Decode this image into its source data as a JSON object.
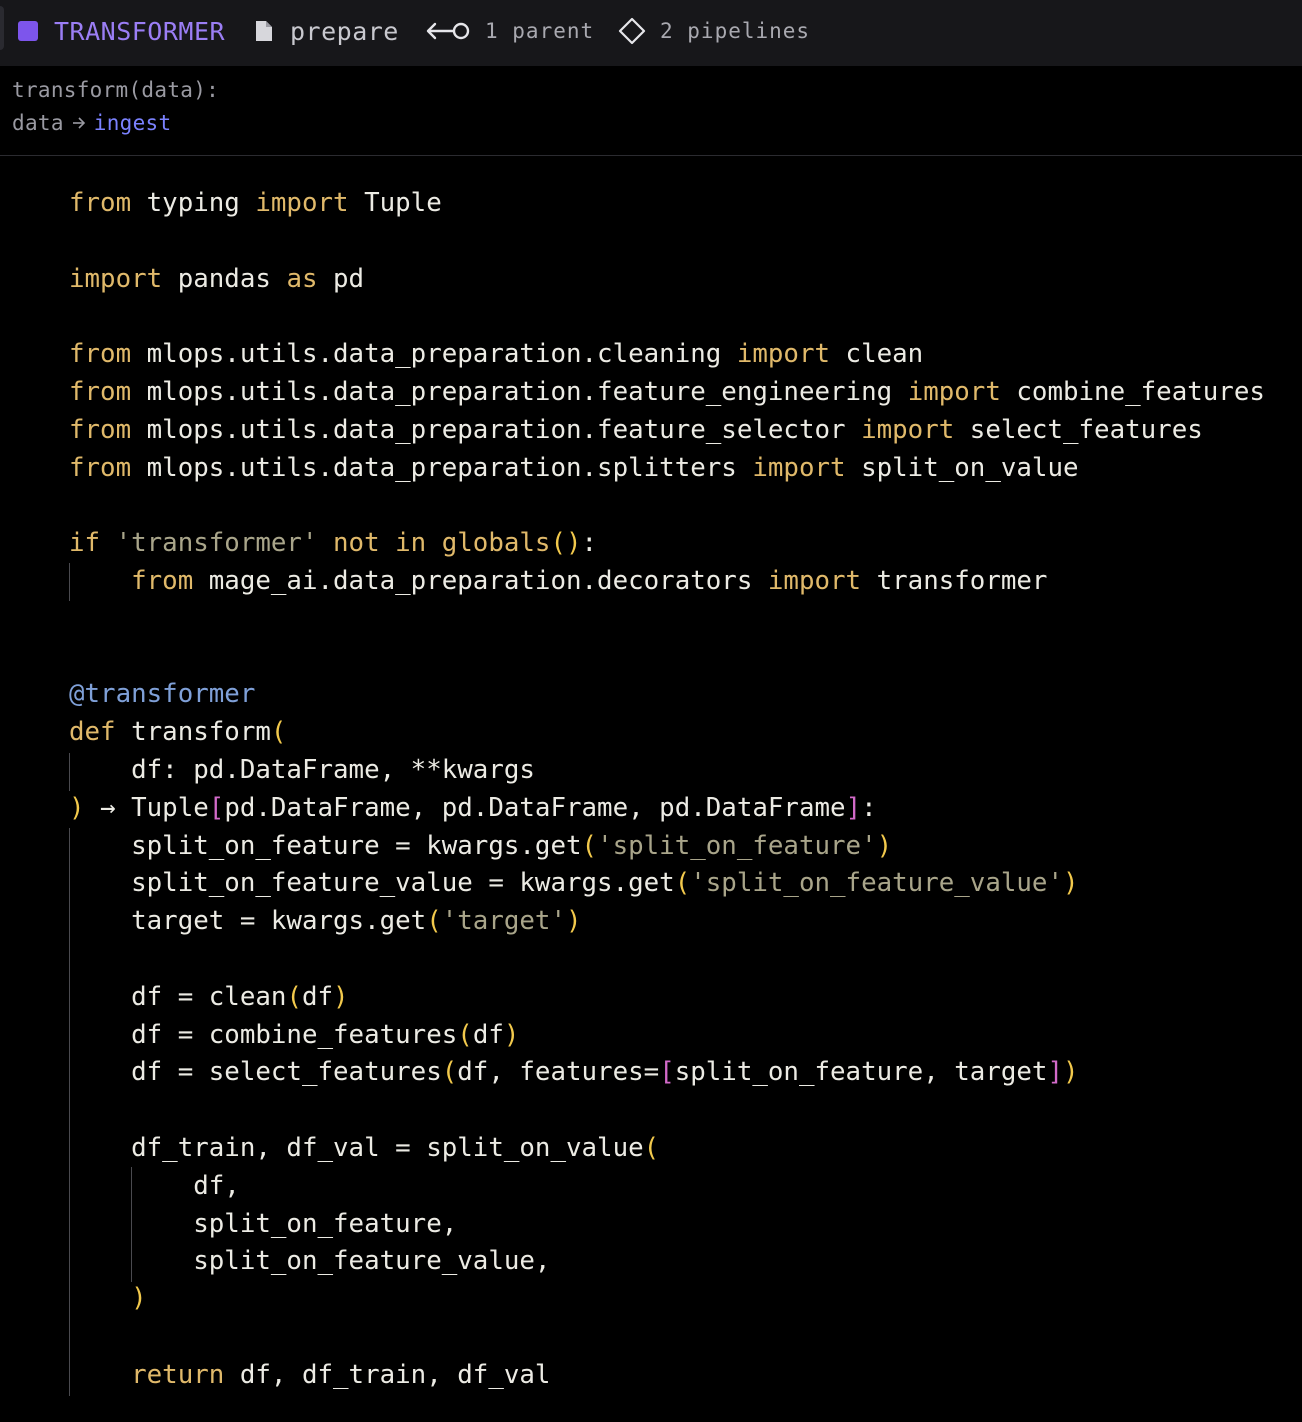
{
  "header": {
    "block_type": "TRANSFORMER",
    "block_type_color": "#7d55ec",
    "file_icon": "file-icon",
    "block_name": "prepare",
    "parents_icon": "parent-link-icon",
    "parents_text": "1 parent",
    "pipelines_icon": "diamond-icon",
    "pipelines_text": "2 pipelines"
  },
  "signature": {
    "function": "transform(data):",
    "flow_from": "data",
    "flow_arrow_icon": "arrow-right-icon",
    "flow_to": "ingest"
  },
  "code": {
    "l1": [
      {
        "t": "from",
        "c": "kw"
      },
      {
        "t": " typing ",
        "c": "txt"
      },
      {
        "t": "import",
        "c": "kw"
      },
      {
        "t": " Tuple",
        "c": "txt"
      }
    ],
    "l3": [
      {
        "t": "import",
        "c": "kw"
      },
      {
        "t": " pandas ",
        "c": "txt"
      },
      {
        "t": "as",
        "c": "kw"
      },
      {
        "t": " pd",
        "c": "txt"
      }
    ],
    "l5": [
      {
        "t": "from",
        "c": "kw"
      },
      {
        "t": " mlops.utils.data_preparation.cleaning ",
        "c": "txt"
      },
      {
        "t": "import",
        "c": "kw"
      },
      {
        "t": " clean",
        "c": "txt"
      }
    ],
    "l6": [
      {
        "t": "from",
        "c": "kw"
      },
      {
        "t": " mlops.utils.data_preparation.feature_engineering ",
        "c": "txt"
      },
      {
        "t": "import",
        "c": "kw"
      },
      {
        "t": " combine_features",
        "c": "txt"
      }
    ],
    "l7": [
      {
        "t": "from",
        "c": "kw"
      },
      {
        "t": " mlops.utils.data_preparation.feature_selector ",
        "c": "txt"
      },
      {
        "t": "import",
        "c": "kw"
      },
      {
        "t": " select_features",
        "c": "txt"
      }
    ],
    "l8": [
      {
        "t": "from",
        "c": "kw"
      },
      {
        "t": " mlops.utils.data_preparation.splitters ",
        "c": "txt"
      },
      {
        "t": "import",
        "c": "kw"
      },
      {
        "t": " split_on_value",
        "c": "txt"
      }
    ],
    "l10": [
      {
        "t": "if",
        "c": "kw"
      },
      {
        "t": " ",
        "c": "txt"
      },
      {
        "t": "'transformer'",
        "c": "str"
      },
      {
        "t": " ",
        "c": "txt"
      },
      {
        "t": "not",
        "c": "kw"
      },
      {
        "t": " ",
        "c": "txt"
      },
      {
        "t": "in",
        "c": "kw"
      },
      {
        "t": " ",
        "c": "txt"
      },
      {
        "t": "globals",
        "c": "kw"
      },
      {
        "t": "()",
        "c": "pn"
      },
      {
        "t": ":",
        "c": "txt"
      }
    ],
    "l11": [
      {
        "t": "    ",
        "c": "txt"
      },
      {
        "t": "from",
        "c": "kw"
      },
      {
        "t": " mage_ai.data_preparation.decorators ",
        "c": "txt"
      },
      {
        "t": "import",
        "c": "kw"
      },
      {
        "t": " transformer",
        "c": "txt"
      }
    ],
    "l14": [
      {
        "t": "@transformer",
        "c": "dec"
      }
    ],
    "l15": [
      {
        "t": "def",
        "c": "kw"
      },
      {
        "t": " transform",
        "c": "txt"
      },
      {
        "t": "(",
        "c": "pn"
      }
    ],
    "l16": [
      {
        "t": "    df: pd.DataFrame, **kwargs",
        "c": "txt"
      }
    ],
    "l17": [
      {
        "t": ")",
        "c": "pn"
      },
      {
        "t": " → Tuple",
        "c": "txt"
      },
      {
        "t": "[",
        "c": "br"
      },
      {
        "t": "pd.DataFrame, pd.DataFrame, pd.DataFrame",
        "c": "txt"
      },
      {
        "t": "]",
        "c": "br"
      },
      {
        "t": ":",
        "c": "txt"
      }
    ],
    "l18": [
      {
        "t": "    split_on_feature = kwargs.get",
        "c": "txt"
      },
      {
        "t": "(",
        "c": "pn"
      },
      {
        "t": "'split_on_feature'",
        "c": "str"
      },
      {
        "t": ")",
        "c": "pn"
      }
    ],
    "l19": [
      {
        "t": "    split_on_feature_value = kwargs.get",
        "c": "txt"
      },
      {
        "t": "(",
        "c": "pn"
      },
      {
        "t": "'split_on_feature_value'",
        "c": "str"
      },
      {
        "t": ")",
        "c": "pn"
      }
    ],
    "l20": [
      {
        "t": "    target = kwargs.get",
        "c": "txt"
      },
      {
        "t": "(",
        "c": "pn"
      },
      {
        "t": "'target'",
        "c": "str"
      },
      {
        "t": ")",
        "c": "pn"
      }
    ],
    "l22": [
      {
        "t": "    df = clean",
        "c": "txt"
      },
      {
        "t": "(",
        "c": "pn"
      },
      {
        "t": "df",
        "c": "txt"
      },
      {
        "t": ")",
        "c": "pn"
      }
    ],
    "l23": [
      {
        "t": "    df = combine_features",
        "c": "txt"
      },
      {
        "t": "(",
        "c": "pn"
      },
      {
        "t": "df",
        "c": "txt"
      },
      {
        "t": ")",
        "c": "pn"
      }
    ],
    "l24": [
      {
        "t": "    df = select_features",
        "c": "txt"
      },
      {
        "t": "(",
        "c": "pn"
      },
      {
        "t": "df, features=",
        "c": "txt"
      },
      {
        "t": "[",
        "c": "br"
      },
      {
        "t": "split_on_feature, target",
        "c": "txt"
      },
      {
        "t": "]",
        "c": "br"
      },
      {
        "t": ")",
        "c": "pn"
      }
    ],
    "l26": [
      {
        "t": "    df_train, df_val = split_on_value",
        "c": "txt"
      },
      {
        "t": "(",
        "c": "pn"
      }
    ],
    "l27": [
      {
        "t": "        df,",
        "c": "txt"
      }
    ],
    "l28": [
      {
        "t": "        split_on_feature,",
        "c": "txt"
      }
    ],
    "l29": [
      {
        "t": "        split_on_feature_value,",
        "c": "txt"
      }
    ],
    "l30": [
      {
        "t": "    ",
        "c": "txt"
      },
      {
        "t": ")",
        "c": "pn"
      }
    ],
    "l32": [
      {
        "t": "    ",
        "c": "txt"
      },
      {
        "t": "return",
        "c": "kw"
      },
      {
        "t": " df, df_train, df_val",
        "c": "txt"
      }
    ]
  }
}
